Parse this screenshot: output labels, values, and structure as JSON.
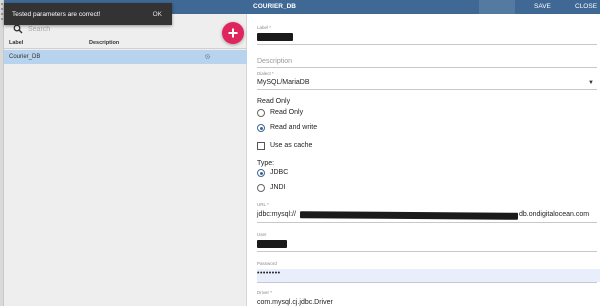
{
  "toast": {
    "message": "Tested parameters are correct!",
    "action": "OK"
  },
  "list": {
    "search_placeholder": "Search",
    "columns": [
      "Label",
      "Description"
    ],
    "rows": [
      {
        "label": "Courier_DB",
        "description": ""
      }
    ]
  },
  "editor": {
    "title": "COURIER_DB",
    "actions": {
      "save": "SAVE",
      "close": "CLOSE"
    },
    "label_field": {
      "label": "Label *",
      "value": ""
    },
    "description_field": {
      "placeholder": "Description"
    },
    "dialect_field": {
      "label": "Dialect *",
      "value": "MySQL/MariaDB"
    },
    "access": {
      "heading": "Read Only",
      "options": [
        "Read Only",
        "Read and write"
      ],
      "selected": "Read and write"
    },
    "cache": {
      "label": "Use as cache",
      "checked": false
    },
    "type": {
      "heading": "Type:",
      "options": [
        "JDBC",
        "JNDI"
      ],
      "selected": "JDBC"
    },
    "url_field": {
      "label": "URL *",
      "value_prefix": "jdbc:mysql://",
      "value_suffix": "db.ondigitalocean.com"
    },
    "user_field": {
      "label": "User",
      "value": ""
    },
    "password_field": {
      "label": "Password",
      "value": "••••••••"
    },
    "driver_field": {
      "label": "Driver *",
      "value": "com.mysql.cj.jdbc.Driver"
    }
  },
  "colors": {
    "topbar": "#3f6895",
    "accent": "#e0245e",
    "selected_row": "#b7d3ee"
  }
}
